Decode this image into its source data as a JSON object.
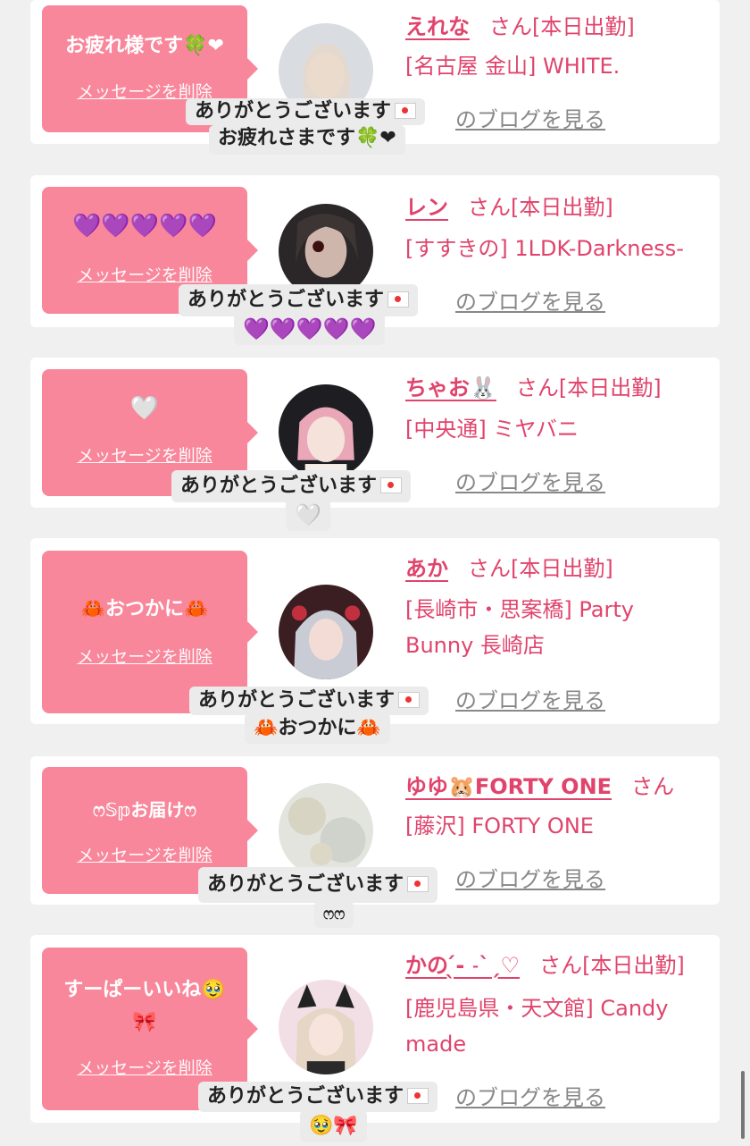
{
  "delete_label": "メッセージを削除",
  "honorific": "さん",
  "blog_label": "のブログを見る",
  "thanks_label": "ありがとうございます",
  "accent_color": "#e0446c",
  "bubble_color": "#f8879b",
  "items": [
    {
      "message": "お疲れ様です🍀❤",
      "name": "えれな",
      "status": "[本日出勤]",
      "area": "[名古屋 金山] WHITE.",
      "area2": "",
      "reply": "お疲れさまです🍀❤"
    },
    {
      "message": "💜💜💜💜💜",
      "name": "レン",
      "status": "[本日出勤]",
      "area": "[すすきの] 1LDK-Darkness-",
      "area2": "",
      "reply": "💜💜💜💜💜"
    },
    {
      "message": "🤍",
      "name": "ちゃお🐰",
      "status": "[本日出勤]",
      "area": "[中央通] ミヤバニ",
      "area2": "",
      "reply": "🤍"
    },
    {
      "message": "🦀おつかに🦀",
      "name": "あか",
      "status": "[本日出勤]",
      "area": "[長崎市・思案橋] Party",
      "area2": "Bunny 長崎店",
      "reply": "🦀おつかに🦀"
    },
    {
      "message": "ෆ𝕊𝕡お届けෆ",
      "name": "ゆゆ🐹FORTY ONE",
      "status": "",
      "area": "[藤沢] FORTY ONE",
      "area2": "",
      "reply": "ෆෆ"
    },
    {
      "message": "すーぱーいいね🥹🎀",
      "name": "かの ̖́-‬ ˗ˋˏ♡",
      "status": "[本日出勤]",
      "area": "[鹿児島県・天文館] Candy",
      "area2": "made",
      "reply": "🥹🎀"
    }
  ]
}
